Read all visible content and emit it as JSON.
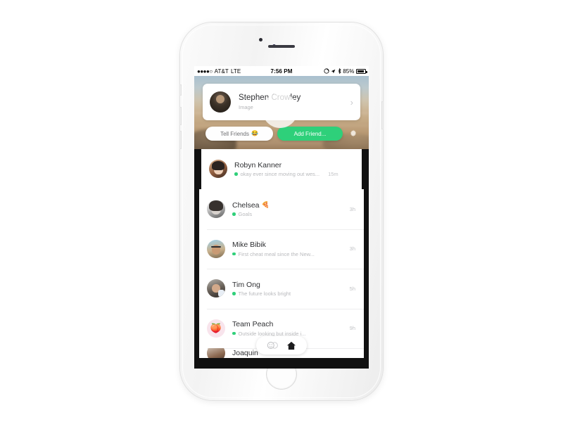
{
  "device": {
    "name": "iphone-white",
    "frame_color": "#f4f4f4"
  },
  "status_bar": {
    "signal_dots": "●●●●○",
    "carrier": "AT&T",
    "network": "LTE",
    "time": "7:56 PM",
    "battery_percent": "85%",
    "icons": [
      "rotation-lock-icon",
      "location-arrow-icon",
      "bluetooth-icon",
      "battery-icon"
    ]
  },
  "header": {
    "profile": {
      "name": "Stephen Crowley",
      "subtitle": "Image",
      "avatar": "stephen-avatar",
      "chevron": "›"
    },
    "actions": {
      "tell_friends_label": "Tell Friends",
      "tell_friends_emoji": "😂",
      "add_friend_label": "Add Friend...",
      "settings_icon": "gear-icon",
      "accent_green": "#2ed07a"
    }
  },
  "chat_list": [
    {
      "name": "Robyn Kanner",
      "emoji": "",
      "preview": "okay ever since moving out wes...",
      "time": "15m",
      "status": "online",
      "avatar": "robyn-avatar"
    },
    {
      "name": "Chelsea",
      "emoji": "🍕",
      "preview": "Goals",
      "time": "3h",
      "status": "online",
      "avatar": "chelsea-avatar"
    },
    {
      "name": "Mike Bibik",
      "emoji": "",
      "preview": "First cheat meal since the New...",
      "time": "3h",
      "status": "online",
      "avatar": "mike-avatar"
    },
    {
      "name": "Tim Ong",
      "emoji": "",
      "preview": "The future looks bright",
      "time": "5h",
      "status": "online",
      "avatar": "tim-avatar"
    },
    {
      "name": "Team Peach",
      "emoji": "",
      "preview": "Outside looking but inside i...",
      "time": "9h",
      "status": "online",
      "avatar": "peach-avatar"
    }
  ],
  "partial_row": {
    "name": "Joaquin",
    "avatar": "last-avatar"
  },
  "tab_bar": {
    "items": [
      {
        "icon": "emoji-faces-icon",
        "active": false
      },
      {
        "icon": "home-icon",
        "active": true
      }
    ]
  }
}
